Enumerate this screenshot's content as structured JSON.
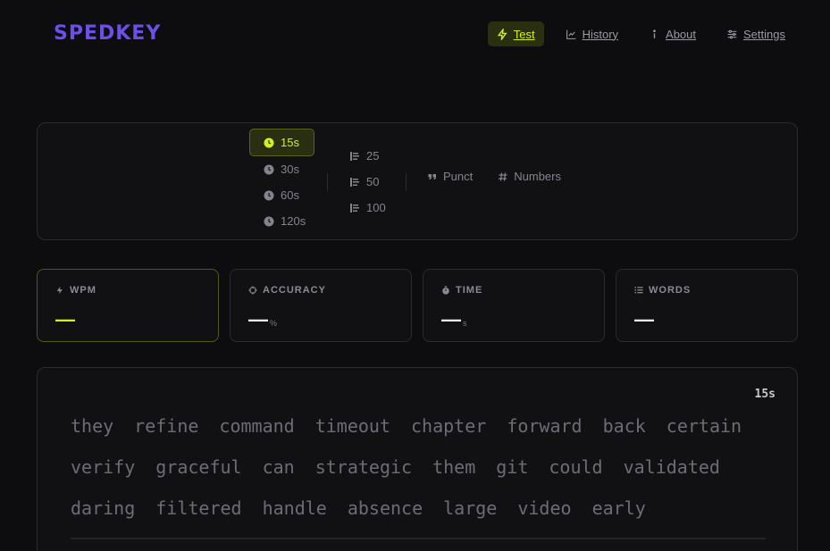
{
  "app": {
    "logo": "SPEDKEY"
  },
  "nav": [
    {
      "label": "Test",
      "icon": "zap-icon",
      "active": true
    },
    {
      "label": "History",
      "icon": "chart-icon",
      "active": false
    },
    {
      "label": "About",
      "icon": "info-icon",
      "active": false
    },
    {
      "label": "Settings",
      "icon": "sliders-icon",
      "active": false
    }
  ],
  "config": {
    "time_options": [
      "15s",
      "30s",
      "60s",
      "120s"
    ],
    "selected_time": "15s",
    "word_options": [
      "25",
      "50",
      "100"
    ],
    "toggles": [
      {
        "label": "Punct",
        "icon": "quote-icon"
      },
      {
        "label": "Numbers",
        "icon": "hash-icon"
      }
    ]
  },
  "stats": [
    {
      "label": "WPM",
      "value": "—",
      "unit": "",
      "icon": "zap-icon"
    },
    {
      "label": "ACCURACY",
      "value": "—",
      "unit": "%",
      "icon": "crosshair-icon"
    },
    {
      "label": "TIME",
      "value": "—",
      "unit": "s",
      "icon": "stopwatch-icon"
    },
    {
      "label": "WORDS",
      "value": "—",
      "unit": "",
      "icon": "list-icon"
    }
  ],
  "typing": {
    "timer": "15s",
    "words": [
      "they",
      "refine",
      "command",
      "timeout",
      "chapter",
      "forward",
      "back",
      "certain",
      "verify",
      "graceful",
      "can",
      "strategic",
      "them",
      "git",
      "could",
      "validated",
      "daring",
      "filtered",
      "handle",
      "absence",
      "large",
      "video",
      "early"
    ]
  },
  "colors": {
    "accent": "#d4f01e",
    "brand": "#6d4fe8",
    "background": "#0d0d0f"
  }
}
